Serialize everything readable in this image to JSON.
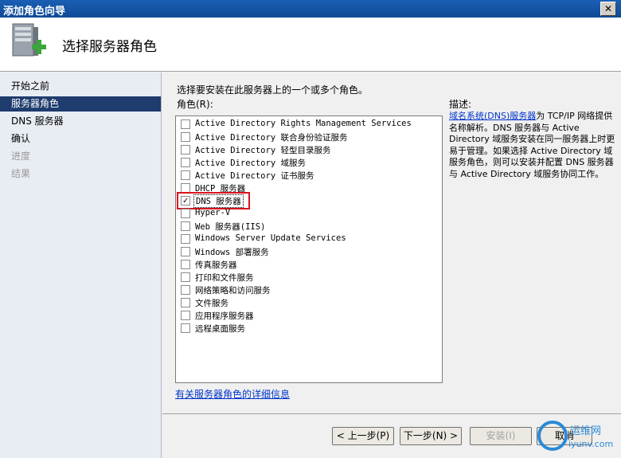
{
  "window": {
    "title": "添加角色向导",
    "close_symbol": "✕"
  },
  "header": {
    "title": "选择服务器角色",
    "icon": "server-add-icon"
  },
  "sidebar": {
    "items": [
      {
        "label": "开始之前",
        "state": "normal"
      },
      {
        "label": "服务器角色",
        "state": "active"
      },
      {
        "label": "DNS 服务器",
        "state": "normal"
      },
      {
        "label": "确认",
        "state": "normal"
      },
      {
        "label": "进度",
        "state": "disabled"
      },
      {
        "label": "结果",
        "state": "disabled"
      }
    ]
  },
  "main": {
    "instruction": "选择要安装在此服务器上的一个或多个角色。",
    "roles_label": "角色(R):",
    "roles": [
      {
        "label": "Active Directory Rights Management Services",
        "checked": false
      },
      {
        "label": "Active Directory 联合身份验证服务",
        "checked": false
      },
      {
        "label": "Active Directory 轻型目录服务",
        "checked": false
      },
      {
        "label": "Active Directory 域服务",
        "checked": false
      },
      {
        "label": "Active Directory 证书服务",
        "checked": false
      },
      {
        "label": "DHCP 服务器",
        "checked": false
      },
      {
        "label": "DNS 服务器",
        "checked": true
      },
      {
        "label": "Hyper-V",
        "checked": false
      },
      {
        "label": "Web 服务器(IIS)",
        "checked": false
      },
      {
        "label": "Windows Server Update Services",
        "checked": false
      },
      {
        "label": "Windows 部署服务",
        "checked": false
      },
      {
        "label": "传真服务器",
        "checked": false
      },
      {
        "label": "打印和文件服务",
        "checked": false
      },
      {
        "label": "网络策略和访问服务",
        "checked": false
      },
      {
        "label": "文件服务",
        "checked": false
      },
      {
        "label": "应用程序服务器",
        "checked": false
      },
      {
        "label": "远程桌面服务",
        "checked": false
      }
    ],
    "description_title": "描述:",
    "description_link": "域名系统(DNS)服务器",
    "description_text": "为 TCP/IP 网络提供名称解析。DNS 服务器与 Active Directory 域服务安装在同一服务器上时更易于管理。如果选择 Active Directory 域服务角色，则可以安装并配置 DNS 服务器与 Active Directory 域服务协同工作。",
    "more_info_link": "有关服务器角色的详细信息"
  },
  "footer": {
    "prev": "< 上一步(P)",
    "next": "下一步(N) >",
    "install": "安装(I)",
    "cancel": "取消"
  },
  "watermark": {
    "text": "运维网",
    "url_text": "iyunv.com"
  },
  "colors": {
    "highlight": "#d9131e",
    "nav_active": "#1e3c6e",
    "link": "#0033cc"
  }
}
